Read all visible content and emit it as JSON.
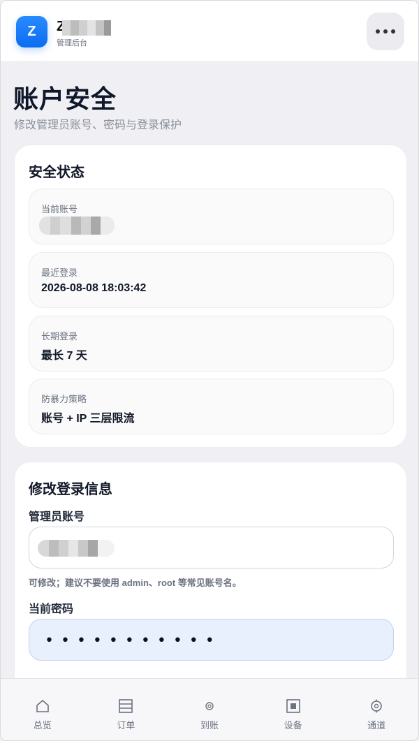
{
  "header": {
    "logo_letter": "Z",
    "brand_name": "Z",
    "brand_sub": "管理后台",
    "more_icon": "more-horizontal-icon"
  },
  "page": {
    "title": "账户安全",
    "subtitle": "修改管理员账号、密码与登录保护"
  },
  "security_status": {
    "title": "安全状态",
    "items": [
      {
        "label": "当前账号",
        "value": ""
      },
      {
        "label": "最近登录",
        "value": "2026-08-08 18:03:42"
      },
      {
        "label": "长期登录",
        "value": "最长 7 天"
      },
      {
        "label": "防暴力策略",
        "value": "账号 + IP 三层限流"
      }
    ]
  },
  "login_form": {
    "title": "修改登录信息",
    "username_label": "管理员账号",
    "username_value": "",
    "username_hint": "可修改；建议不要使用 admin、root 等常见账号名。",
    "password_label": "当前密码",
    "password_mask": "•••••••••••"
  },
  "bottom_nav": [
    {
      "label": "总览",
      "icon": "home-icon"
    },
    {
      "label": "订单",
      "icon": "list-icon"
    },
    {
      "label": "到账",
      "icon": "target-icon"
    },
    {
      "label": "设备",
      "icon": "device-icon"
    },
    {
      "label": "通道",
      "icon": "settings-icon"
    }
  ],
  "colors": {
    "accent": "#0a6cf0",
    "background": "#f0f0f4",
    "password_fill": "#e8f0fe"
  }
}
